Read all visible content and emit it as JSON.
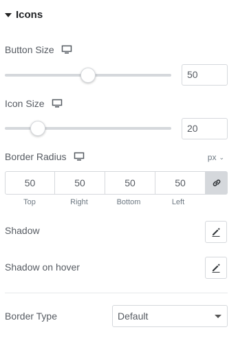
{
  "section": {
    "title": "Icons",
    "icon": "caret-down-icon"
  },
  "button_size": {
    "label": "Button Size",
    "device_icon": "desktop-monitor-icon",
    "value": "50",
    "slider_fraction": 0.5
  },
  "icon_size": {
    "label": "Icon Size",
    "device_icon": "desktop-monitor-icon",
    "value": "20",
    "slider_fraction": 0.2
  },
  "border_radius": {
    "label": "Border Radius",
    "device_icon": "desktop-monitor-icon",
    "unit": "px",
    "unit_chevron": "⌄",
    "values": [
      "50",
      "50",
      "50",
      "50"
    ],
    "labels": [
      "Top",
      "Right",
      "Bottom",
      "Left"
    ],
    "link_icon": "link-icon"
  },
  "shadow": {
    "label": "Shadow",
    "icon": "pencil-edit-icon"
  },
  "shadow_hover": {
    "label": "Shadow on hover",
    "icon": "pencil-edit-icon"
  },
  "border_type": {
    "label": "Border Type",
    "selected": "Default"
  }
}
